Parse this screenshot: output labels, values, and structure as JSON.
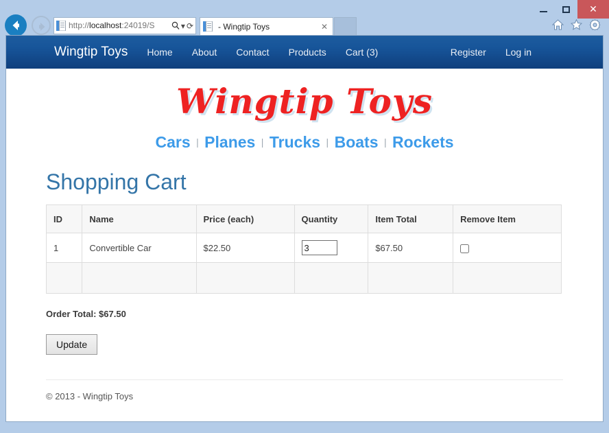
{
  "window": {
    "minimize_label": "minimize",
    "maximize_label": "maximize",
    "close_label": "✕"
  },
  "browser": {
    "back_label": "Back",
    "forward_label": "Forward",
    "url_prefix": "http://",
    "url_host": "localhost",
    "url_rest": ":24019/S",
    "search_icon": "search-icon",
    "dropdown_icon": "▾",
    "refresh_icon": "⟳",
    "tab_title": "- Wingtip Toys",
    "tab_close": "✕",
    "home_icon": "home-icon",
    "favorites_icon": "star-icon",
    "settings_icon": "gear-icon"
  },
  "site_nav": {
    "brand": "Wingtip Toys",
    "links": [
      {
        "label": "Home"
      },
      {
        "label": "About"
      },
      {
        "label": "Contact"
      },
      {
        "label": "Products"
      },
      {
        "label": "Cart (3)"
      }
    ],
    "right_links": [
      {
        "label": "Register"
      },
      {
        "label": "Log in"
      }
    ]
  },
  "logo": {
    "text": "Wingtip Toys",
    "color": "#ee2222",
    "shadow_color": "#cfe3f0"
  },
  "categories": {
    "separator": "|",
    "items": [
      {
        "label": "Cars"
      },
      {
        "label": "Planes"
      },
      {
        "label": "Trucks"
      },
      {
        "label": "Boats"
      },
      {
        "label": "Rockets"
      }
    ],
    "link_color": "#3d9be9"
  },
  "main": {
    "title": "Shopping Cart",
    "title_color": "#3475a8",
    "table": {
      "headers": [
        "ID",
        "Name",
        "Price (each)",
        "Quantity",
        "Item Total",
        "Remove Item"
      ],
      "rows": [
        {
          "id": "1",
          "name": "Convertible Car",
          "price": "$22.50",
          "quantity": "3",
          "item_total": "$67.50",
          "remove_checked": false
        }
      ]
    },
    "order_total_label": "Order Total: $67.50",
    "update_button": "Update"
  },
  "footer": {
    "copyright": "© 2013 - Wingtip Toys"
  }
}
